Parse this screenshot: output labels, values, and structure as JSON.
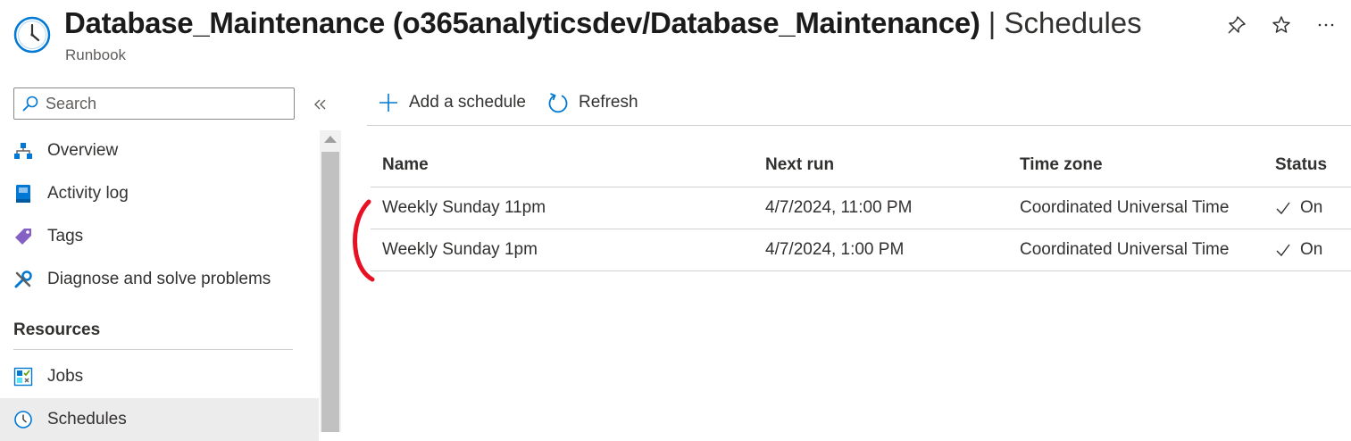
{
  "header": {
    "title_main": "Database_Maintenance (o365analyticsdev/Database_Maintenance)",
    "title_separator": "|",
    "title_section": "Schedules",
    "subtitle": "Runbook",
    "icon": "clock-icon",
    "actions": [
      {
        "name": "pin",
        "icon": "pin-icon"
      },
      {
        "name": "favorite",
        "icon": "star-icon"
      },
      {
        "name": "more",
        "icon": "ellipsis-icon"
      }
    ]
  },
  "sidebar": {
    "search": {
      "placeholder": "Search",
      "value": ""
    },
    "collapse_icon": "double-chevron-left-icon",
    "items": [
      {
        "label": "Overview",
        "icon": "overview-hierarchy-icon"
      },
      {
        "label": "Activity log",
        "icon": "activity-log-icon"
      },
      {
        "label": "Tags",
        "icon": "tag-icon"
      },
      {
        "label": "Diagnose and solve problems",
        "icon": "wrench-icon"
      }
    ],
    "section_resources": "Resources",
    "resource_items": [
      {
        "label": "Jobs",
        "icon": "jobs-icon"
      },
      {
        "label": "Schedules",
        "icon": "clock-icon",
        "selected": true
      }
    ]
  },
  "toolbar": {
    "add_label": "Add a schedule",
    "refresh_label": "Refresh"
  },
  "table": {
    "columns": [
      "Name",
      "Next run",
      "Time zone",
      "Status"
    ],
    "rows": [
      {
        "name": "Weekly Sunday 11pm",
        "next_run": "4/7/2024, 11:00 PM",
        "time_zone": "Coordinated Universal Time",
        "status": "On"
      },
      {
        "name": "Weekly Sunday 1pm",
        "next_run": "4/7/2024, 1:00 PM",
        "time_zone": "Coordinated Universal Time",
        "status": "On"
      }
    ]
  },
  "colors": {
    "accent": "#0078d4",
    "annotation": "#e81123",
    "selected_bg": "#ececec",
    "border": "#d2d0ce"
  }
}
